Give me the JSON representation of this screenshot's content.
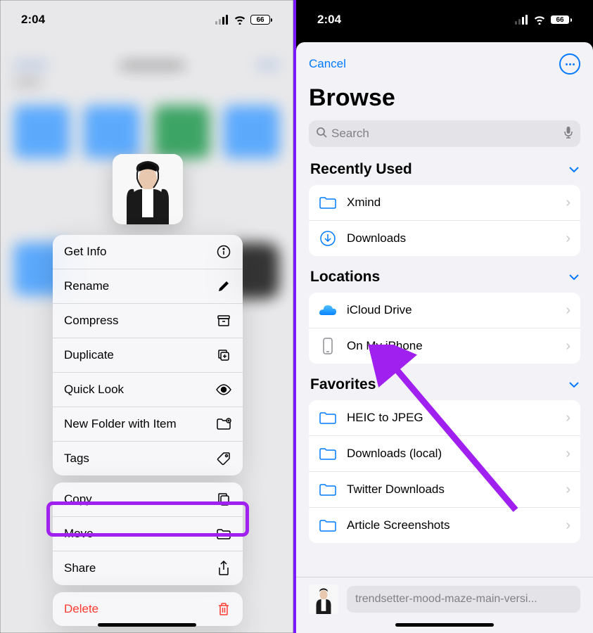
{
  "status": {
    "time": "2:04",
    "battery": "66"
  },
  "left": {
    "menu": {
      "group1": [
        {
          "label": "Get Info",
          "icon": "info"
        },
        {
          "label": "Rename",
          "icon": "pencil"
        },
        {
          "label": "Compress",
          "icon": "archive"
        },
        {
          "label": "Duplicate",
          "icon": "duplicate"
        },
        {
          "label": "Quick Look",
          "icon": "eye"
        },
        {
          "label": "New Folder with Item",
          "icon": "newfolder"
        },
        {
          "label": "Tags",
          "icon": "tag"
        }
      ],
      "group2": [
        {
          "label": "Copy",
          "icon": "copy"
        },
        {
          "label": "Move",
          "icon": "folder"
        },
        {
          "label": "Share",
          "icon": "share"
        }
      ],
      "group3": [
        {
          "label": "Delete",
          "icon": "trash",
          "destructive": true
        }
      ]
    }
  },
  "right": {
    "cancel": "Cancel",
    "title": "Browse",
    "search_placeholder": "Search",
    "sections": {
      "recently_used": {
        "title": "Recently Used",
        "items": [
          "Xmind",
          "Downloads"
        ]
      },
      "locations": {
        "title": "Locations",
        "items": [
          "iCloud Drive",
          "On My iPhone"
        ]
      },
      "favorites": {
        "title": "Favorites",
        "items": [
          "HEIC to JPEG",
          "Downloads (local)",
          "Twitter Downloads",
          "Article Screenshots"
        ]
      }
    },
    "selected_file": "trendsetter-mood-maze-main-versi..."
  }
}
